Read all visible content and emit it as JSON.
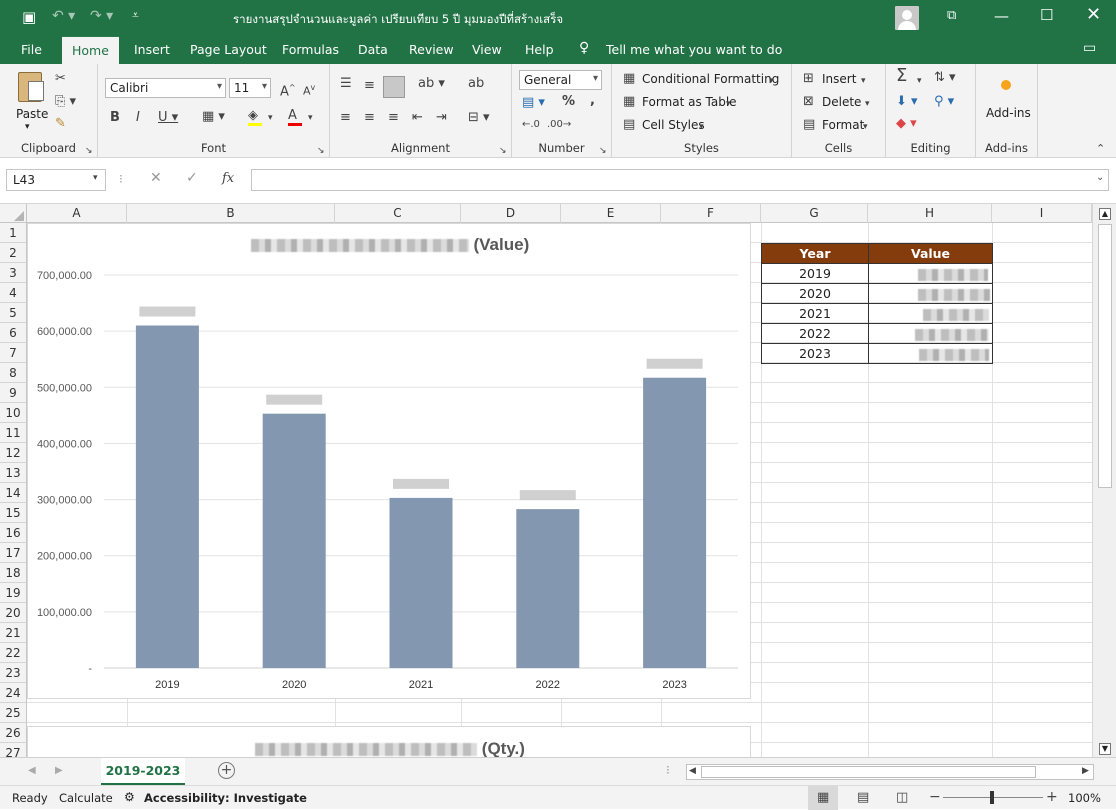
{
  "window": {
    "title": "รายงานสรุปจำนวนและมูลค่า เปรียบเทียบ 5 ปี มุมมองปีที่สร้างเสร็จ"
  },
  "tabs": [
    {
      "label": "File"
    },
    {
      "label": "Home"
    },
    {
      "label": "Insert"
    },
    {
      "label": "Page Layout"
    },
    {
      "label": "Formulas"
    },
    {
      "label": "Data"
    },
    {
      "label": "Review"
    },
    {
      "label": "View"
    },
    {
      "label": "Help"
    }
  ],
  "tell_me": "Tell me what you want to do",
  "ribbon": {
    "clipboard": {
      "paste": "Paste",
      "label": "Clipboard"
    },
    "font": {
      "name": "Calibri",
      "size": "11",
      "label": "Font"
    },
    "alignment": {
      "label": "Alignment"
    },
    "number": {
      "format": "General",
      "label": "Number"
    },
    "styles": {
      "conditional": "Conditional Formatting",
      "table": "Format as Table",
      "cell": "Cell Styles",
      "label": "Styles"
    },
    "cells": {
      "insert": "Insert",
      "delete": "Delete",
      "format": "Format",
      "label": "Cells"
    },
    "editing": {
      "label": "Editing"
    },
    "addins": {
      "button": "Add-ins",
      "label": "Add-ins"
    }
  },
  "formula_bar": {
    "name_box": "L43",
    "fx": "fx",
    "formula": ""
  },
  "columns": [
    "A",
    "B",
    "C",
    "D",
    "E",
    "F",
    "G",
    "H",
    "I"
  ],
  "rows": [
    "1",
    "2",
    "3",
    "4",
    "5",
    "6",
    "7",
    "8",
    "9",
    "10",
    "11",
    "12",
    "13",
    "14",
    "15",
    "16",
    "17",
    "18",
    "19",
    "20",
    "21",
    "22",
    "23",
    "24",
    "25",
    "26",
    "27"
  ],
  "table": {
    "headers": [
      "Year",
      "Value"
    ],
    "years": [
      "2019",
      "2020",
      "2021",
      "2022",
      "2023"
    ]
  },
  "chart_data": [
    {
      "type": "bar",
      "title": "(Value)",
      "categories": [
        "2019",
        "2020",
        "2021",
        "2022",
        "2023"
      ],
      "values": [
        610000,
        453000,
        303000,
        283000,
        517000
      ],
      "ylim": [
        0,
        700000
      ],
      "yticks": [
        "-",
        "100,000.00",
        "200,000.00",
        "300,000.00",
        "400,000.00",
        "500,000.00",
        "600,000.00",
        "700,000.00"
      ],
      "bar_color": "#8497b0",
      "grid": true
    },
    {
      "type": "bar",
      "title": "(Qty.)"
    }
  ],
  "sheet": {
    "tab": "2019-2023"
  },
  "status": {
    "ready": "Ready",
    "calculate": "Calculate",
    "accessibility": "Accessibility: Investigate",
    "zoom": "100%"
  }
}
